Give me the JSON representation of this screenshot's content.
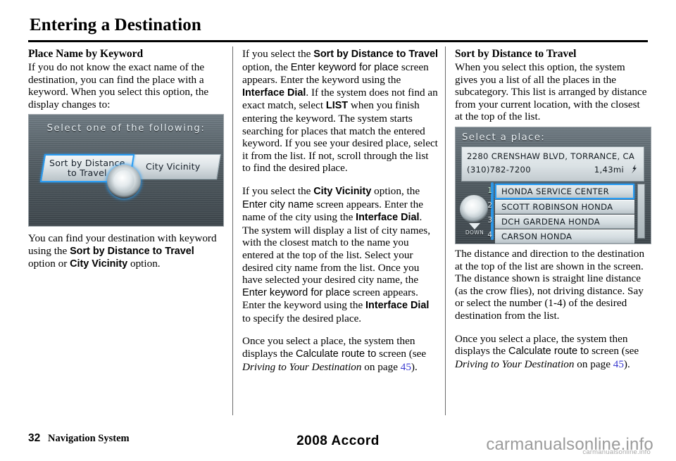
{
  "page": {
    "title": "Entering a Destination",
    "footer_page_number": "32",
    "footer_section": "Navigation System",
    "footer_model": "2008  Accord",
    "watermark": "carmanualsonline.info",
    "watermark_sub": "carmanualsonline.info"
  },
  "column_1": {
    "heading": "Place Name by Keyword",
    "paragraph_1": "If you do not know the exact name of the destination, you can find the place with a keyword. When you select this option, the display changes to:",
    "caption_parts": {
      "p1": "You can find your destination with keyword using the ",
      "b1": "Sort by Distance to Travel",
      "p2": " option or ",
      "b2": "City Vicinity",
      "p3": " option."
    }
  },
  "column_2": {
    "paragraph_1_parts": {
      "p1": "If you select the ",
      "b1": "Sort by Distance to Travel",
      "p2": " option, the ",
      "s1": "Enter keyword for place",
      "p3": " screen appears. Enter the keyword using the ",
      "b2": "Interface Dial",
      "p4": ". If the system does not find an exact match, select ",
      "b3": "LIST",
      "p5": " when you finish entering the keyword. The system starts searching for places that match the entered keyword. If you see your desired place, select it from the list. If not, scroll through the list to find the desired place."
    },
    "paragraph_2_parts": {
      "p1": "If you select the ",
      "b1": "City Vicinity",
      "p2": " option, the ",
      "s1": "Enter city name",
      "p3": " screen appears. Enter the name of the city using the ",
      "b2": "Interface Dial",
      "p4": ". The system will display a list of city names, with the closest match to the name you entered at the top of the list. Select your desired city name from the list. Once you have selected your desired city name, the ",
      "s2": "Enter keyword for place",
      "p5": " screen appears. Enter the keyword using the ",
      "b3": "Interface Dial",
      "p6": " to specify the desired place."
    },
    "paragraph_3_parts": {
      "p1": "Once you select a place, the system then displays the ",
      "s1": "Calculate route to",
      "p2": " screen (see ",
      "i1": "Driving to Your Destination",
      "p3": " on page ",
      "link": "45",
      "p4": ")."
    }
  },
  "column_3": {
    "heading": "Sort by Distance to Travel",
    "paragraph_1": "When you select this option, the system gives you a list of all the places in the subcategory. This list is arranged by distance from your current location, with the closest at the top of the list.",
    "paragraph_2": "The distance and direction to the destination at the top of the list are shown in the screen. The distance shown is straight line distance (as the crow flies), not driving distance. Say or select the number (1-4) of the desired destination from the list.",
    "paragraph_3_parts": {
      "p1": "Once you select a place, the system then displays the ",
      "s1": "Calculate route to",
      "p2": " screen (see ",
      "i1": "Driving to Your Destination",
      "p3": " on page ",
      "link": "45",
      "p4": ")."
    }
  },
  "navshot_1": {
    "title": "Select one of the following:",
    "button_left_line1": "Sort by Distance",
    "button_left_line2": "to Travel",
    "button_right": "City Vicinity",
    "highlight_color": "#2a9df4"
  },
  "navshot_2": {
    "title": "Select a place:",
    "address": "2280 CRENSHAW BLVD, TORRANCE, CA",
    "phone": "(310)782-7200",
    "distance": "1,43mi",
    "direction_icon": "direction-arrow-icon",
    "dial_down_label": "DOWN",
    "numbers": [
      "1",
      "2",
      "3",
      "4"
    ],
    "list_items": [
      "HONDA SERVICE CENTER",
      "SCOTT ROBINSON HONDA",
      "DCH GARDENA HONDA",
      "CARSON HONDA"
    ],
    "selected_index": 0,
    "highlight_color": "#2a9df4"
  }
}
